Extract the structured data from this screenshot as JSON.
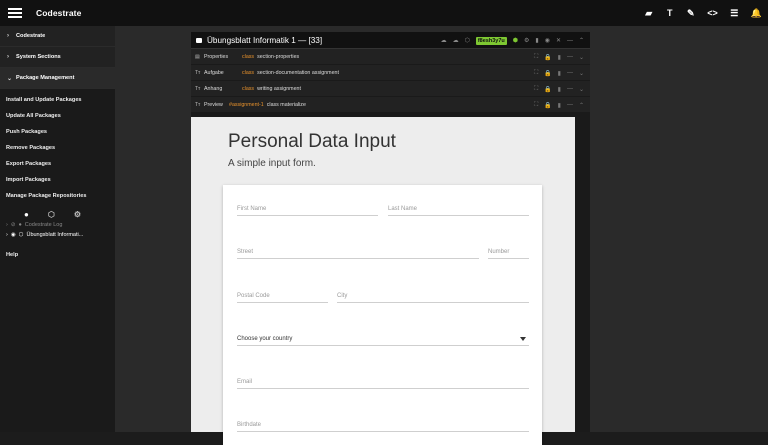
{
  "app": {
    "title": "Codestrate"
  },
  "toolbar": {
    "icons": [
      "label-icon",
      "text-format-icon",
      "brush-icon",
      "code-icon",
      "list-icon",
      "bell-icon"
    ]
  },
  "sidebar": {
    "sections": [
      {
        "label": "Codestrate"
      },
      {
        "label": "System Sections"
      },
      {
        "label": "Package Management"
      }
    ],
    "items": [
      "Install and Update Packages",
      "Update All Packages",
      "Push Packages",
      "Remove Packages",
      "Export Packages",
      "Import Packages",
      "Manage Package Repositories"
    ],
    "tree": [
      {
        "label": "Codestrate Log"
      },
      {
        "label": "Übungsblatt Informati..."
      }
    ],
    "help": "Help"
  },
  "panel": {
    "title": "Übungsblatt Informatik 1 — [33]",
    "hash": "f8esh3y7u",
    "rows": [
      {
        "name": "Properties",
        "cls": "class",
        "value": "section-properties"
      },
      {
        "name": "Aufgabe",
        "cls": "class",
        "value": "section-documentation assignment"
      },
      {
        "name": "Anhang",
        "cls": "class",
        "value": "writing assignment"
      },
      {
        "name": "Preview",
        "cls": "#assignment-1",
        "value": "class materialize"
      }
    ]
  },
  "form": {
    "title": "Personal Data Input",
    "subtitle": "A simple input form.",
    "first_name": "First Name",
    "last_name": "Last Name",
    "street": "Street",
    "number": "Number",
    "postal_code": "Postal Code",
    "city": "City",
    "country": "Choose your country",
    "email": "Email",
    "birthdate": "Birthdate"
  }
}
